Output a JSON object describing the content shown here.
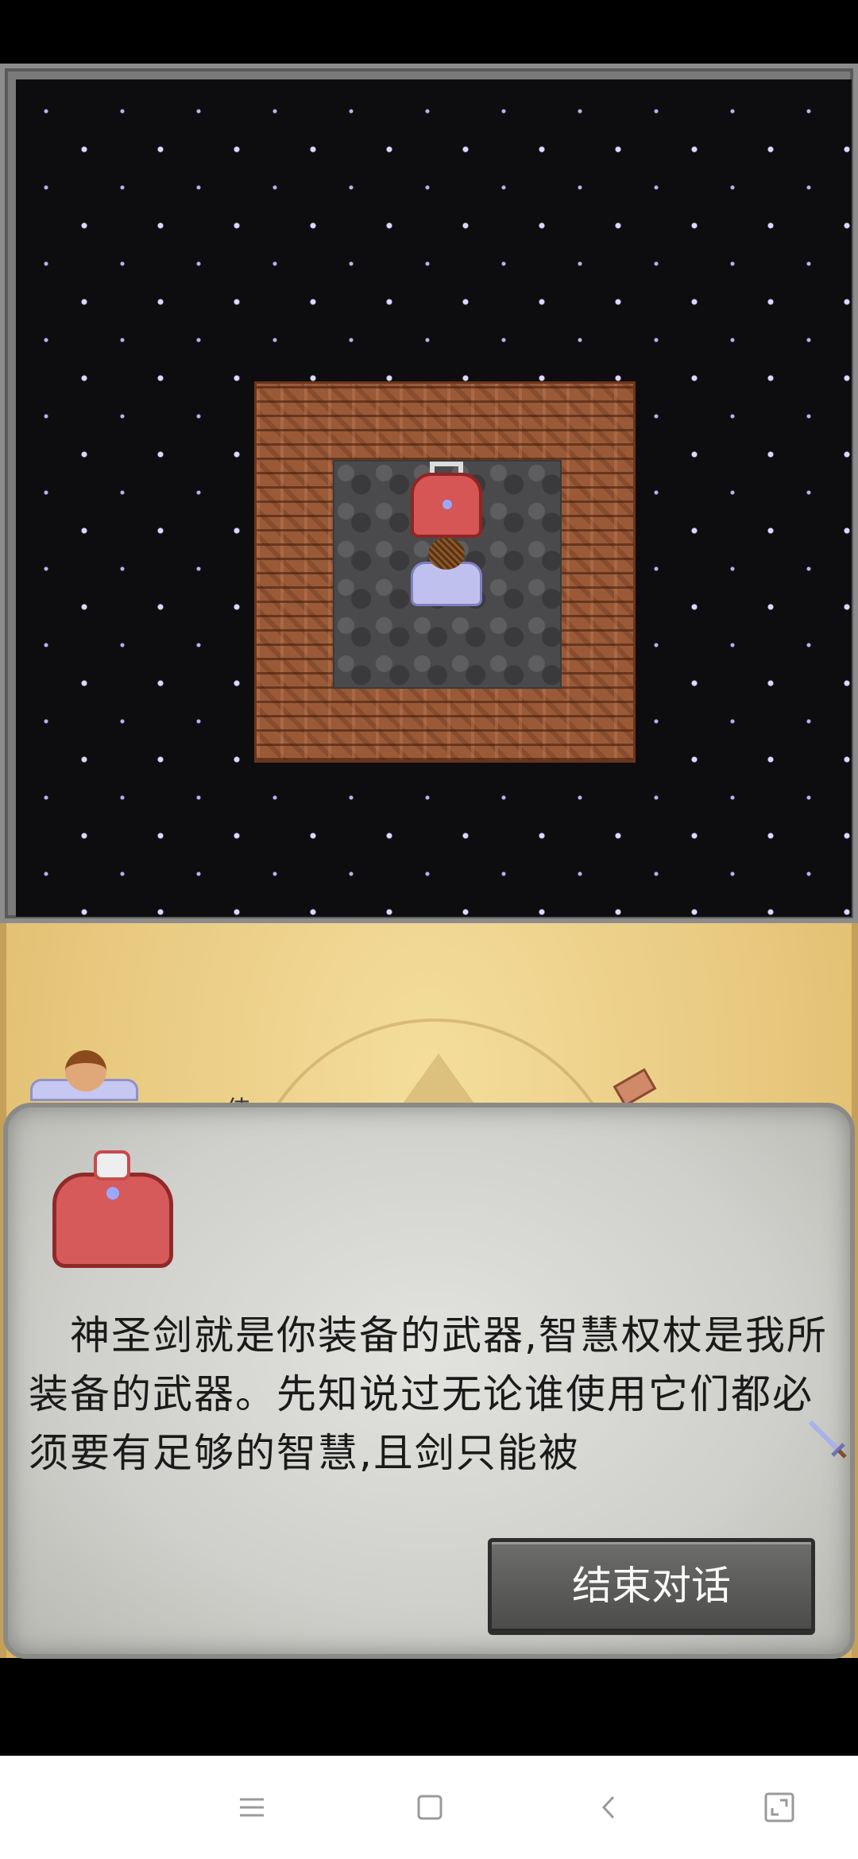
{
  "dialog": {
    "partial_label": "侍...",
    "text": "　神圣剑就是你装备的武器,智慧权杖是我所装备的武器。先知说过无论谁使用它们都必须要有足够的智慧,且剑只能被",
    "end_button_label": "结束对话"
  },
  "icons": {
    "menu": "menu-icon",
    "home": "home-square-icon",
    "back": "back-chevron-icon",
    "recent": "corner-expand-icon",
    "continue": "sword-icon"
  },
  "colors": {
    "starfield": "#0d0d10",
    "wall": "#9a5a38",
    "floor": "#4a4a4c",
    "parchment": "#e7c77c",
    "panel": "#cfcfcb",
    "button": "#5a5a58"
  }
}
